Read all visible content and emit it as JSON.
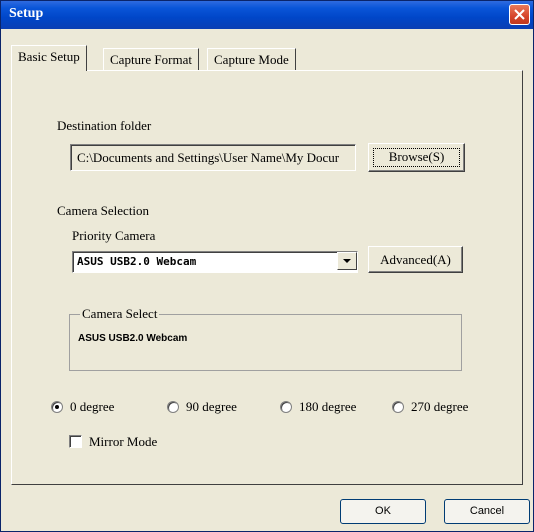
{
  "window": {
    "title": "Setup"
  },
  "tabs": [
    {
      "label": "Basic Setup",
      "active": true
    },
    {
      "label": "Capture Format",
      "active": false
    },
    {
      "label": "Capture Mode",
      "active": false
    }
  ],
  "destination": {
    "label": "Destination folder",
    "path": "C:\\Documents and Settings\\User Name\\My Docur",
    "browse_label": "Browse(S)"
  },
  "camera": {
    "section_label": "Camera Selection",
    "priority_label": "Priority Camera",
    "priority_value": "ASUS USB2.0 Webcam",
    "advanced_label": "Advanced(A)",
    "select_group_label": "Camera Select",
    "select_value": "ASUS USB2.0 Webcam"
  },
  "rotation": {
    "options": [
      {
        "label": "0 degree",
        "selected": true
      },
      {
        "label": "90 degree",
        "selected": false
      },
      {
        "label": "180 degree",
        "selected": false
      },
      {
        "label": "270 degree",
        "selected": false
      }
    ]
  },
  "mirror": {
    "label": "Mirror Mode",
    "checked": false
  },
  "footer": {
    "ok_label": "OK",
    "cancel_label": "Cancel"
  },
  "colors": {
    "titlebar": "#0046c8",
    "close": "#d6452b",
    "dialog_face": "#ece9d8"
  }
}
